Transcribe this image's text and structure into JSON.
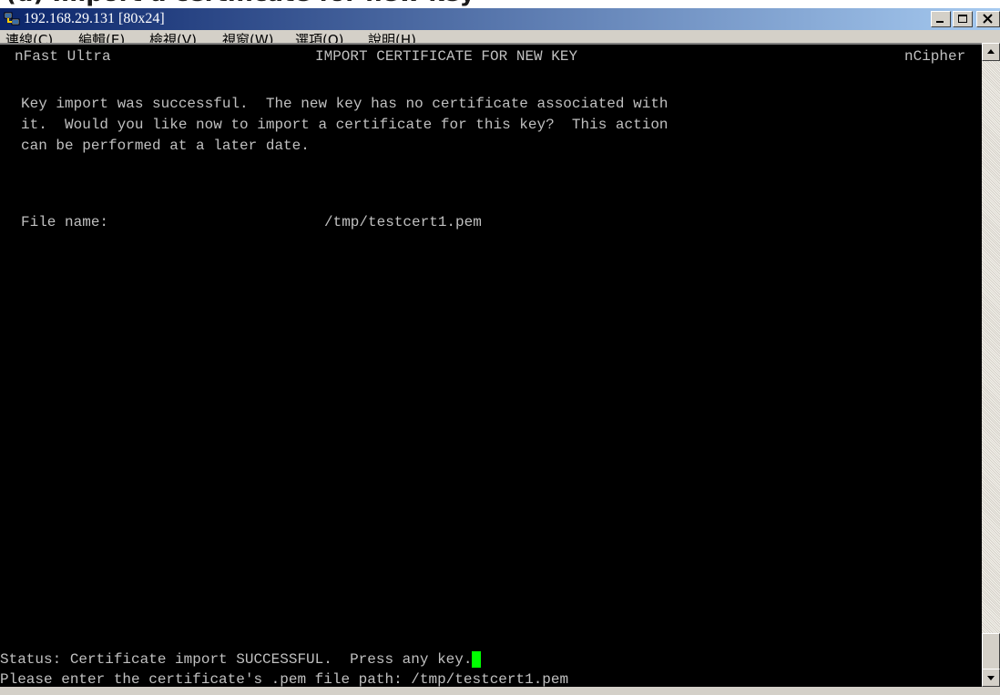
{
  "page_heading": "(d) Import a certificate for new key",
  "window": {
    "title": "192.168.29.131 [80x24]",
    "icon": "network-computers-icon"
  },
  "menu": {
    "items": [
      "連線(C)",
      "編輯(E)",
      "檢視(V)",
      "視窗(W)",
      "選項(O)",
      "說明(H)"
    ]
  },
  "terminal": {
    "header_left": "nFast Ultra",
    "header_center": "IMPORT CERTIFICATE FOR NEW KEY",
    "header_right": "nCipher",
    "message_lines": [
      "Key import was successful.  The new key has no certificate associated with",
      "it.  Would you like now to import a certificate for this key?  This action",
      "can be performed at a later date."
    ],
    "file_label": "File name:",
    "file_value": "/tmp/testcert1.pem",
    "status_line": "Status: Certificate import SUCCESSFUL.  Press any key.",
    "prompt_line": "Please enter the certificate's .pem file path: /tmp/testcert1.pem"
  },
  "colors": {
    "terminal_bg": "#000000",
    "terminal_fg": "#c0c0c0",
    "cursor": "#00ff00",
    "titlebar": "#0a246a"
  }
}
